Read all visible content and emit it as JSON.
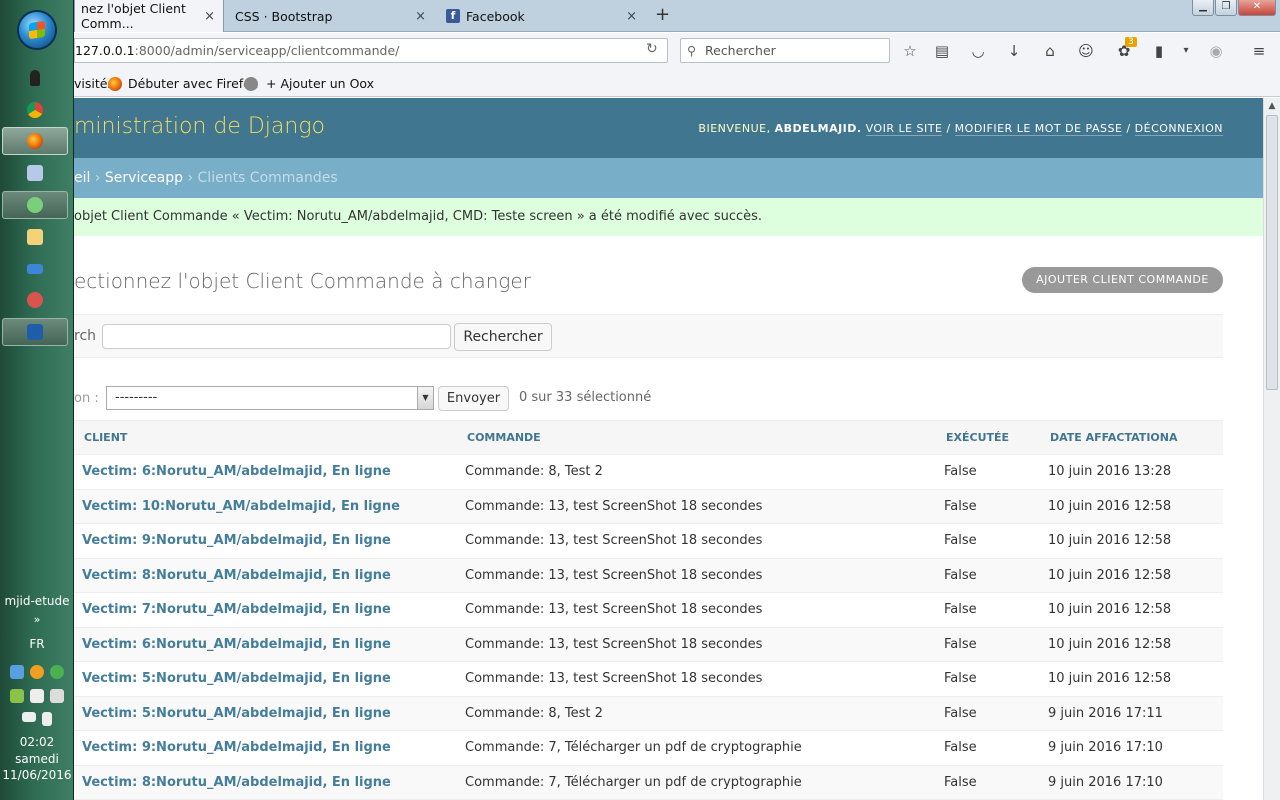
{
  "taskbar": {
    "user": "mjid-etude",
    "chevron": "»",
    "lang": "FR",
    "time": "02:02",
    "day": "samedi",
    "date": "11/06/2016"
  },
  "tabs": [
    {
      "label": "nez l'objet Client Comm...",
      "close": "×"
    },
    {
      "label": "CSS · Bootstrap",
      "close": "×"
    },
    {
      "label": "Facebook",
      "close": "×"
    }
  ],
  "newtab": "+",
  "window_buttons": {
    "minimize": "▁",
    "maximize": "❐",
    "close": "✕"
  },
  "nav": {
    "url_host": "127.0.0.1",
    "url_path": ":8000/admin/serviceapp/clientcommande/",
    "search_placeholder": "Rechercher",
    "notification_count": "3"
  },
  "bookmarks": [
    {
      "label": "visités"
    },
    {
      "label": "Débuter avec Firefox"
    },
    {
      "label": "+ Ajouter un Oox"
    }
  ],
  "django": {
    "branding": "ministration de Django",
    "welcome": "BIENVENUE,",
    "username": "ABDELMAJID.",
    "view_site": "VOIR LE SITE",
    "change_password": "MODIFIER LE MOT DE PASSE",
    "logout": "DÉCONNEXION",
    "separator": "/",
    "breadcrumb_home": "eil",
    "breadcrumb_app": "Serviceapp",
    "breadcrumb_current": "Clients Commandes",
    "breadcrumb_sep": "›",
    "message": "objet Client Commande « Vectim: Norutu_AM/abdelmajid, CMD: Teste screen » a été modifié avec succès.",
    "title": "ectionnez l'objet Client Commande à changer",
    "add_button": "AJOUTER CLIENT COMMANDE",
    "search_label": "rch",
    "search_button": "Rechercher",
    "action_label": "on :",
    "action_value": "---------",
    "envoyer": "Envoyer",
    "selected_count": "0 sur 33 sélectionné"
  },
  "table": {
    "headers": [
      "CLIENT",
      "COMMANDE",
      "EXÉCUTÉE",
      "DATE AFFACTATIONA"
    ],
    "rows": [
      [
        "Vectim: 6:Norutu_AM/abdelmajid, En ligne",
        "Commande: 8, Test 2",
        "False",
        "10 juin 2016 13:28"
      ],
      [
        "Vectim: 10:Norutu_AM/abdelmajid, En ligne",
        "Commande: 13, test ScreenShot 18 secondes",
        "False",
        "10 juin 2016 12:58"
      ],
      [
        "Vectim: 9:Norutu_AM/abdelmajid, En ligne",
        "Commande: 13, test ScreenShot 18 secondes",
        "False",
        "10 juin 2016 12:58"
      ],
      [
        "Vectim: 8:Norutu_AM/abdelmajid, En ligne",
        "Commande: 13, test ScreenShot 18 secondes",
        "False",
        "10 juin 2016 12:58"
      ],
      [
        "Vectim: 7:Norutu_AM/abdelmajid, En ligne",
        "Commande: 13, test ScreenShot 18 secondes",
        "False",
        "10 juin 2016 12:58"
      ],
      [
        "Vectim: 6:Norutu_AM/abdelmajid, En ligne",
        "Commande: 13, test ScreenShot 18 secondes",
        "False",
        "10 juin 2016 12:58"
      ],
      [
        "Vectim: 5:Norutu_AM/abdelmajid, En ligne",
        "Commande: 13, test ScreenShot 18 secondes",
        "False",
        "10 juin 2016 12:58"
      ],
      [
        "Vectim: 5:Norutu_AM/abdelmajid, En ligne",
        "Commande: 8, Test 2",
        "False",
        "9 juin 2016 17:11"
      ],
      [
        "Vectim: 9:Norutu_AM/abdelmajid, En ligne",
        "Commande: 7, Télécharger un pdf de cryptographie",
        "False",
        "9 juin 2016 17:10"
      ],
      [
        "Vectim: 8:Norutu_AM/abdelmajid, En ligne",
        "Commande: 7, Télécharger un pdf de cryptographie",
        "False",
        "9 juin 2016 17:10"
      ]
    ]
  }
}
